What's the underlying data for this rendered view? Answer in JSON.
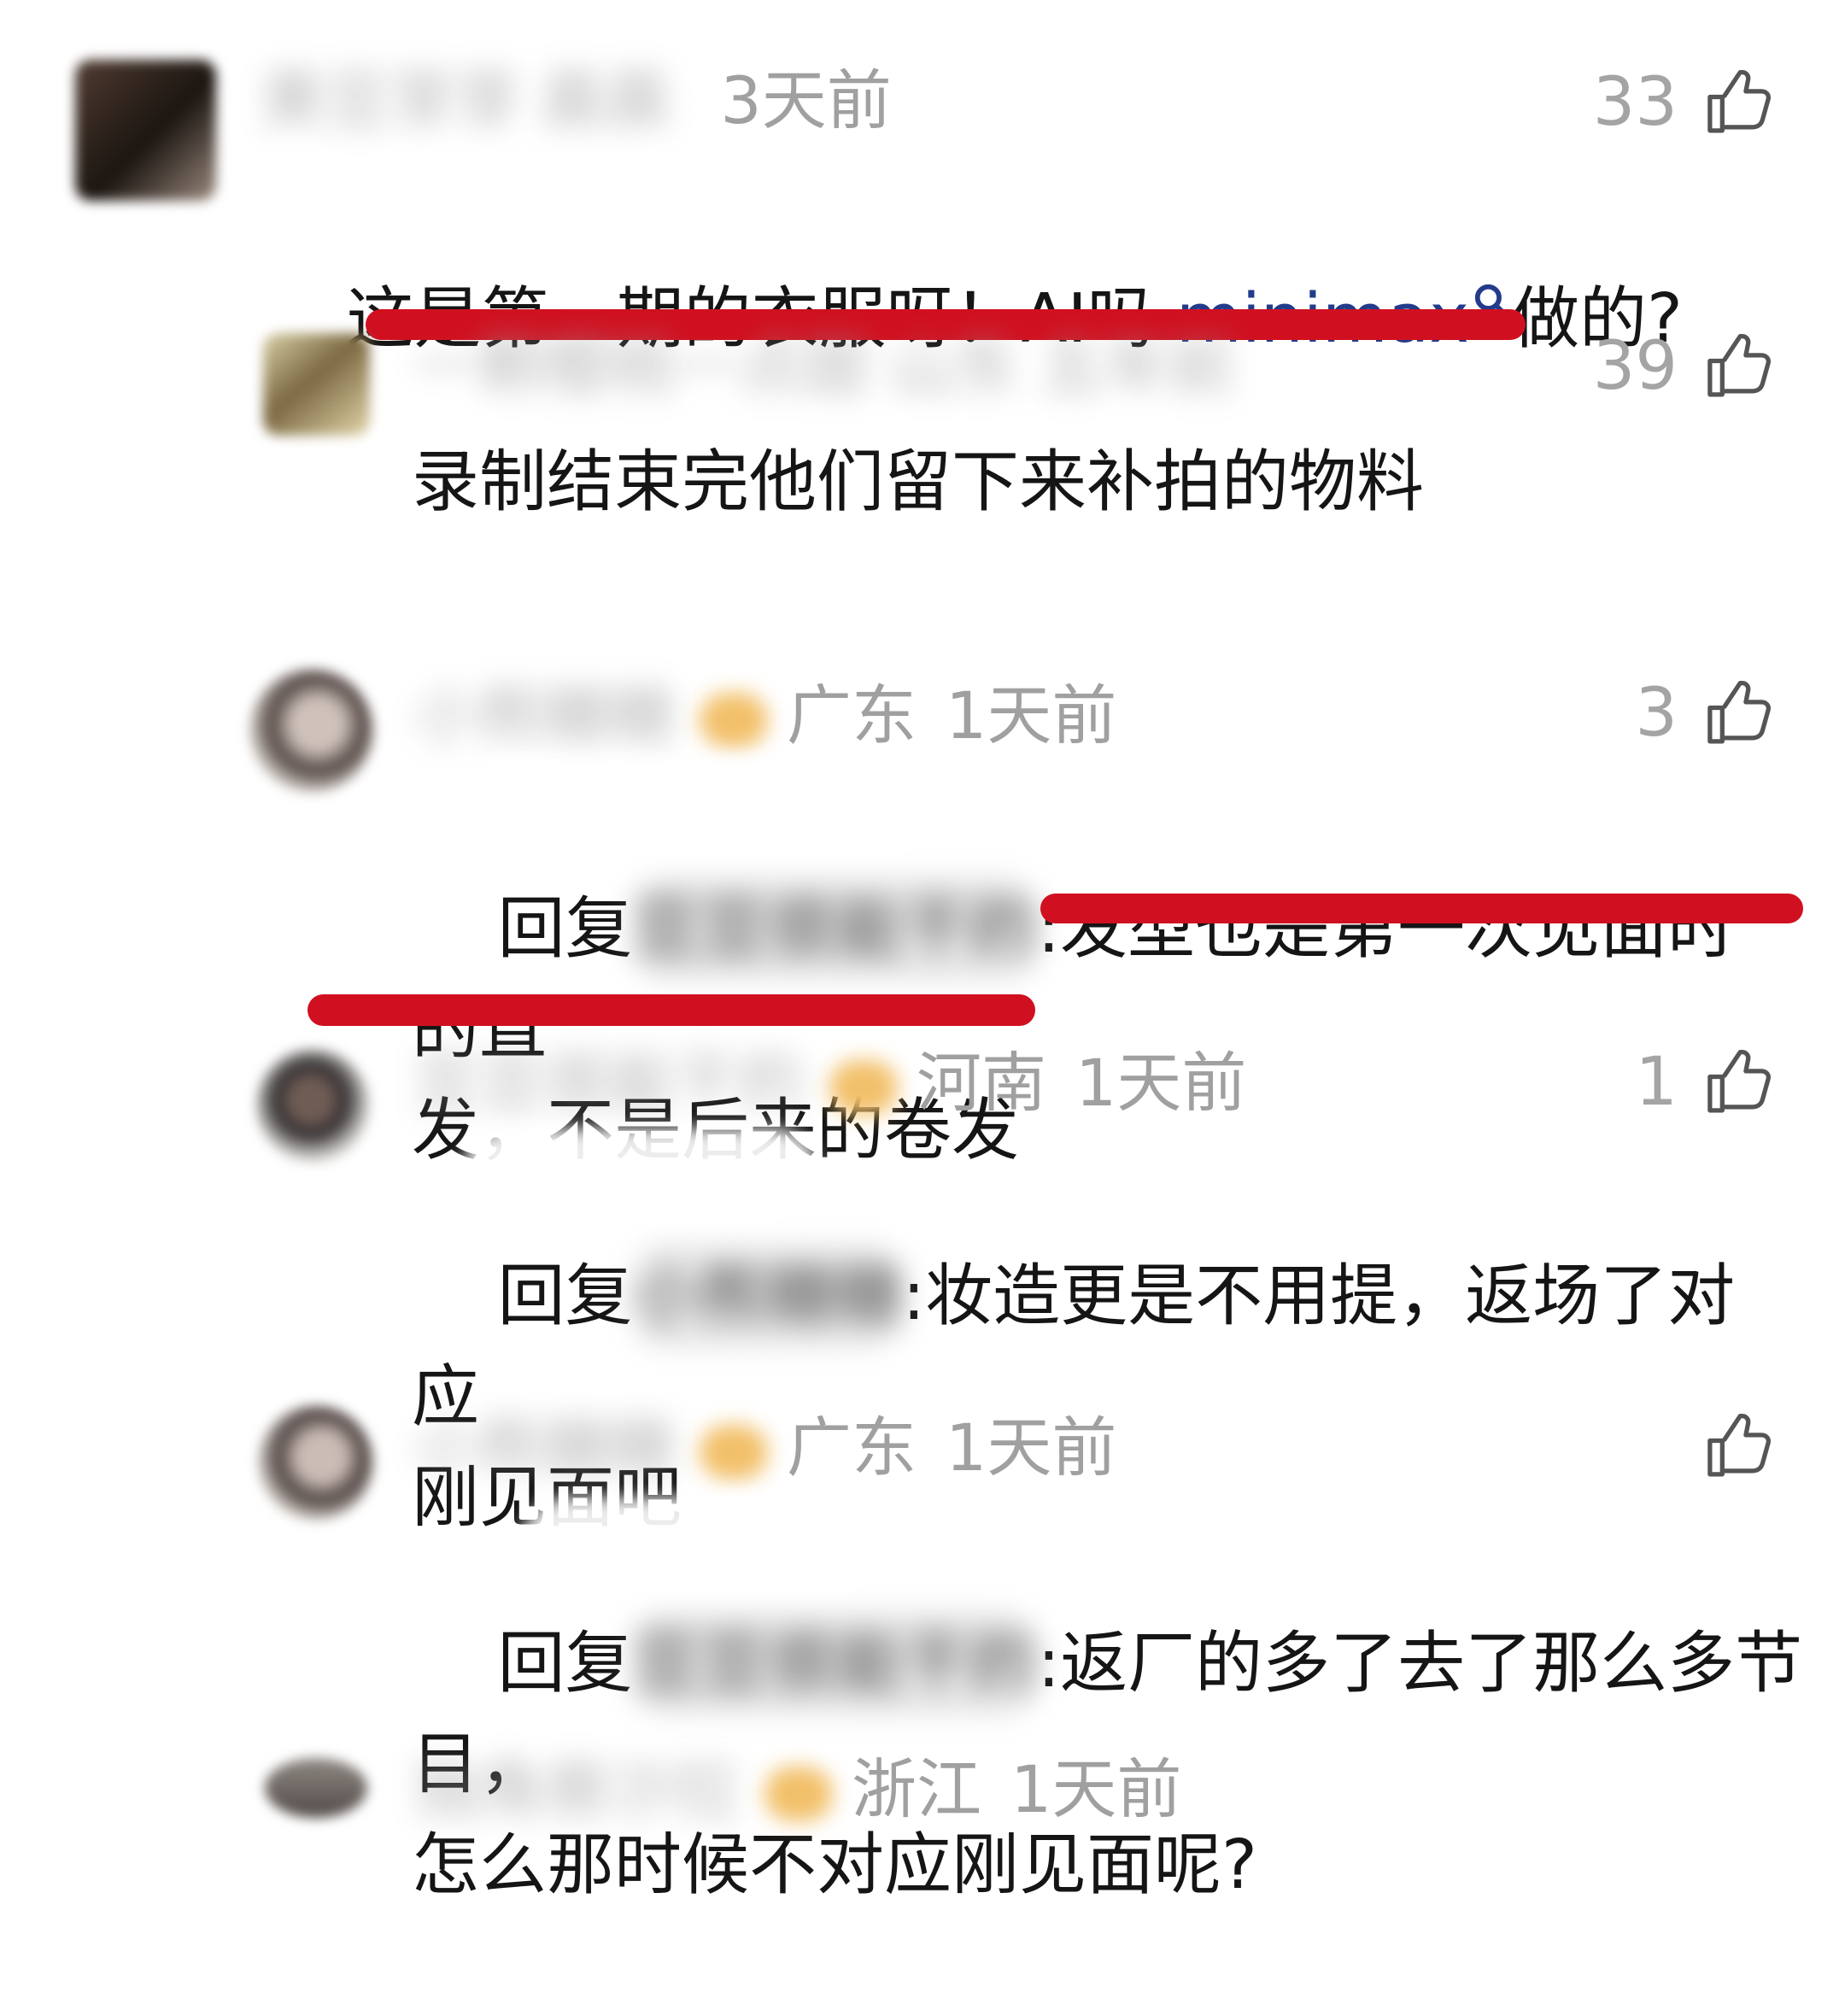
{
  "comments": [
    {
      "user": "黄豆芽芽 晨晨",
      "time": "3天前",
      "likes": "33",
      "text_before": "这是第一期的衣服呀！AI吗 ",
      "keyword": "minimax",
      "text_after": "做的?"
    },
    {
      "user": "一颗樱桃一点甜 山东 五年前",
      "likes": "39",
      "text": "录制结束完他们留下来补拍的物料"
    },
    {
      "user": "小熊糖糖",
      "region": "广东",
      "time": "1天前",
      "likes": "3",
      "reply_prefix": "回复",
      "reply_target": "豆豆很能干的",
      "text": ":发型也是第一次见面时的直\n发，不是后来的卷发"
    },
    {
      "user": "豆豆很能干的",
      "region": "河南",
      "time": "1天前",
      "likes": "1",
      "reply_prefix": "回复",
      "reply_target": "小熊糖糖",
      "text": ":妆造更是不用提，返场了对应\n刚见面吧"
    },
    {
      "user": "小熊糖糖",
      "region": "广东",
      "time": "1天前",
      "likes": "",
      "reply_prefix": "回复",
      "reply_target": "豆豆很能干的",
      "text": ":返厂的多了去了那么多节目，\n怎么那时候不对应刚见面呢?"
    },
    {
      "user": "独角兽沙拉",
      "region": "浙江",
      "time": "1天前"
    }
  ],
  "colors": {
    "highlight_red": "#d01020",
    "keyword_blue": "#223b8b",
    "meta_gray": "#a0a0a0"
  },
  "icons": [
    "thumbs-up-icon",
    "search-icon"
  ]
}
